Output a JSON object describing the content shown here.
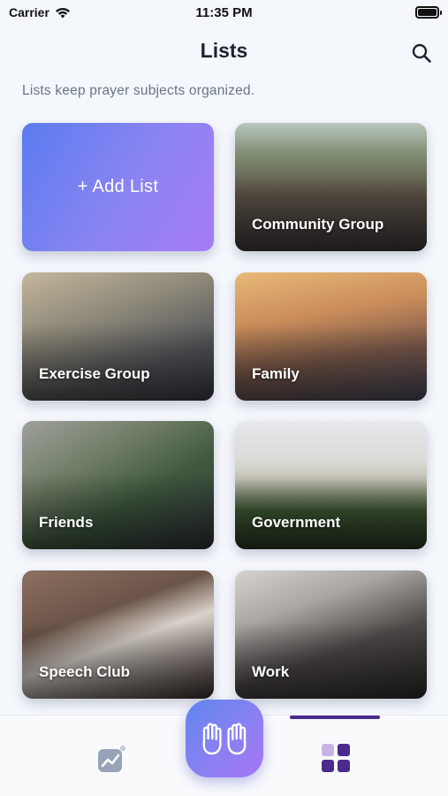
{
  "status_bar": {
    "carrier": "Carrier",
    "time": "11:35 PM"
  },
  "header": {
    "title": "Lists",
    "subtitle": "Lists keep prayer subjects organized."
  },
  "add_card": {
    "label": "+ Add List"
  },
  "lists": [
    {
      "label": "Community Group"
    },
    {
      "label": "Exercise Group"
    },
    {
      "label": "Family"
    },
    {
      "label": "Friends"
    },
    {
      "label": "Government"
    },
    {
      "label": "Speech Club"
    },
    {
      "label": "Work"
    }
  ],
  "tab_bar": {
    "tabs": [
      {
        "icon": "stats-chart-icon",
        "selected": false
      },
      {
        "icon": "praying-hands-icon",
        "selected": false
      },
      {
        "icon": "grid-icon",
        "selected": true
      }
    ],
    "accent_color": "#4b2a8e"
  },
  "colors": {
    "gradient_start": "#5b7cf0",
    "gradient_end": "#a77cf6",
    "background": "#f4f7fc"
  }
}
